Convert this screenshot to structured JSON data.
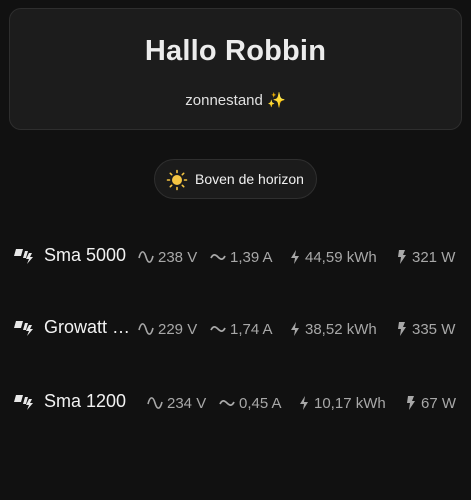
{
  "greeting": {
    "title": "Hallo Robbin",
    "subtitle": "zonnestand",
    "subtitle_emoji": "✨"
  },
  "sun_chip": {
    "icon": "sun-icon",
    "label": "Boven de horizon"
  },
  "colors": {
    "background": "#111111",
    "card": "#1c1c1c",
    "sun": "#f5c542",
    "metric_text": "#a8a8a8"
  },
  "inverters": [
    {
      "name": "Sma 5000",
      "voltage": "238 V",
      "current": "1,39 A",
      "energy": "44,59 kWh",
      "power": "321 W"
    },
    {
      "name": "Growatt …",
      "voltage": "229 V",
      "current": "1,74 A",
      "energy": "38,52 kWh",
      "power": "335 W"
    },
    {
      "name": "Sma 1200",
      "voltage": "234 V",
      "current": "0,45 A",
      "energy": "10,17 kWh",
      "power": "67 W"
    }
  ],
  "metric_icons": {
    "voltage": "sine-wave-icon",
    "current": "tilde-wave-icon",
    "energy": "lightning-bolt-icon",
    "power": "flash-icon",
    "inverter": "solar-power-icon"
  }
}
